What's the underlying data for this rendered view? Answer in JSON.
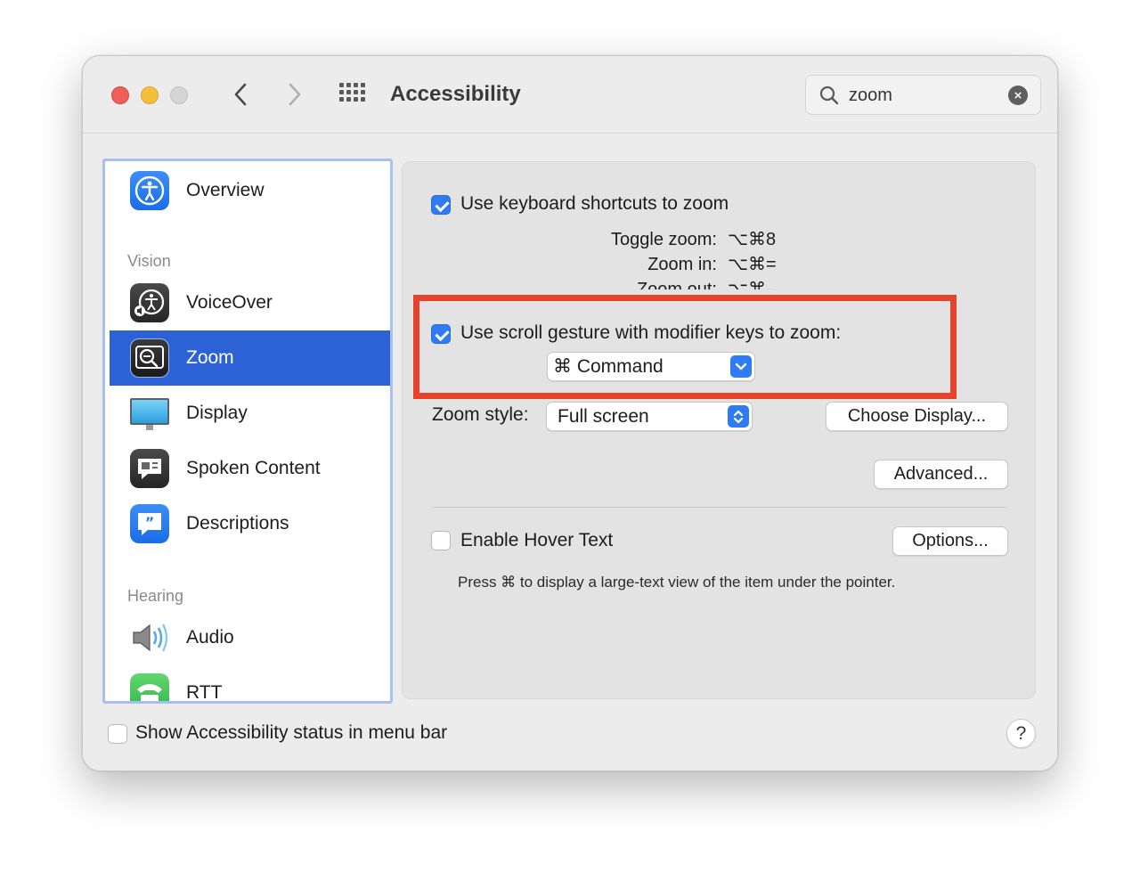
{
  "window": {
    "title": "Accessibility"
  },
  "search": {
    "value": "zoom",
    "icon": "magnifier-icon",
    "clear_icon": "clear-icon"
  },
  "sidebar": {
    "items": [
      {
        "label": "Overview",
        "icon": "accessibility-person-icon"
      },
      {
        "label": "VoiceOver",
        "icon": "voiceover-icon"
      },
      {
        "label": "Zoom",
        "icon": "zoom-icon",
        "selected": true
      },
      {
        "label": "Display",
        "icon": "display-monitor-icon"
      },
      {
        "label": "Spoken Content",
        "icon": "speech-bubble-icon"
      },
      {
        "label": "Descriptions",
        "icon": "quote-bubble-icon"
      },
      {
        "label": "Audio",
        "icon": "speaker-icon"
      },
      {
        "label": "RTT",
        "icon": "telephone-icon"
      }
    ],
    "sections": {
      "vision": "Vision",
      "hearing": "Hearing"
    },
    "selection_color": "#2c62d6"
  },
  "zoom_pane": {
    "keyboard_shortcuts": {
      "label": "Use keyboard shortcuts to zoom",
      "checked": true,
      "shortcuts": [
        {
          "label": "Toggle zoom:",
          "keys": "⌥⌘8"
        },
        {
          "label": "Zoom in:",
          "keys": "⌥⌘="
        },
        {
          "label": "Zoom out:",
          "keys": "⌥⌘-"
        }
      ]
    },
    "scroll_gesture": {
      "label": "Use scroll gesture with modifier keys to zoom:",
      "checked": true,
      "modifier": "⌘ Command"
    },
    "zoom_style": {
      "label": "Zoom style:",
      "value": "Full screen"
    },
    "choose_display_button": "Choose Display...",
    "advanced_button": "Advanced...",
    "hover_text": {
      "label": "Enable Hover Text",
      "checked": false,
      "options_button": "Options...",
      "note": "Press ⌘ to display a large-text view of the item under the pointer."
    }
  },
  "footer": {
    "status_checkbox_label": "Show Accessibility status in menu bar",
    "checked": false,
    "help_label": "?"
  },
  "colors": {
    "accent": "#2f7bf5",
    "highlight_box": "#e6432e"
  }
}
